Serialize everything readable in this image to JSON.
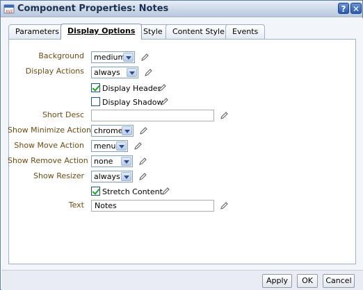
{
  "window": {
    "title": "Component Properties: Notes",
    "help_label": "?",
    "close_label": "✕"
  },
  "tabs": [
    {
      "label": "Parameters",
      "active": false
    },
    {
      "label": "Display Options",
      "active": true
    },
    {
      "label": "Style",
      "active": false
    },
    {
      "label": "Content Style",
      "active": false
    },
    {
      "label": "Events",
      "active": false
    }
  ],
  "form": {
    "background": {
      "label": "Background",
      "value": "medium"
    },
    "display_actions": {
      "label": "Display Actions",
      "value": "always"
    },
    "display_header": {
      "label": "Display Header",
      "checked": true
    },
    "display_shadow": {
      "label": "Display Shadow",
      "checked": false
    },
    "short_desc": {
      "label": "Short Desc",
      "value": ""
    },
    "show_minimize": {
      "label": "Show Minimize Action",
      "value": "chrome"
    },
    "show_move": {
      "label": "Show Move Action",
      "value": "menu"
    },
    "show_remove": {
      "label": "Show Remove Action",
      "value": "none"
    },
    "show_resizer": {
      "label": "Show Resizer",
      "value": "always"
    },
    "stretch_content": {
      "label": "Stretch Content",
      "checked": true
    },
    "text": {
      "label": "Text",
      "value": "Notes"
    }
  },
  "footer": {
    "apply_label": "Apply",
    "ok_label": "OK",
    "cancel_label": "Cancel"
  },
  "colors": {
    "label_text": "#6b4b12",
    "title_text": "#1f2f4f",
    "check_green": "#21a121"
  }
}
